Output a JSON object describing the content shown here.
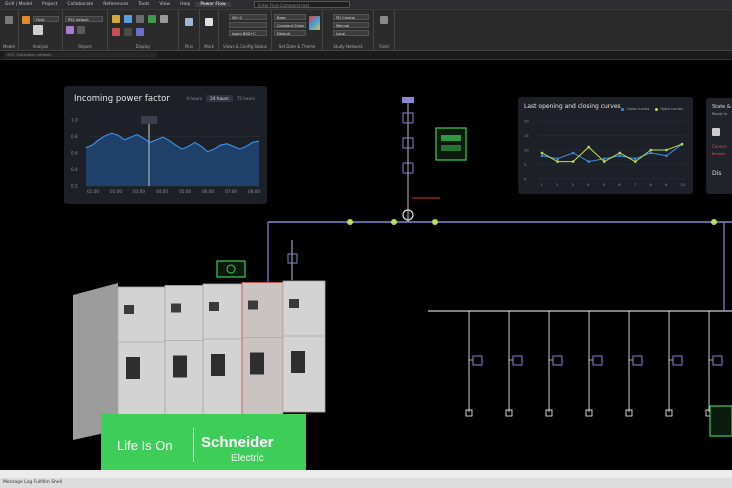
{
  "menubar": {
    "items": [
      "Grill | Model",
      "Project",
      "Collaborate",
      "References",
      "Tools",
      "View",
      "Help",
      "Power Flow"
    ],
    "search_placeholder": "Enter Find Command text"
  },
  "ribbon": {
    "groups": [
      "Model",
      "Analyze",
      "Report",
      "Display",
      "Pins",
      "Mark",
      "Views & Config Status",
      "Set Date & Theme",
      "Study Network",
      "Field"
    ],
    "controls": {
      "analyze_select": "Fault",
      "report_select": "PSC default",
      "views_select1": "SB+C",
      "views_select2": "",
      "views_select3": "Isang BSD+C",
      "theme_select1": "Base",
      "theme_select2": "Constant Show",
      "theme_select3": "Default",
      "network_select1": "PD Control",
      "network_select2": "Manual",
      "network_select3": "Local"
    }
  },
  "docbar": {
    "tab": "XYZ- Substation network"
  },
  "power_factor": {
    "title": "Incoming power factor",
    "tabs": [
      "4 hours",
      "24 hours",
      "72 hours"
    ],
    "selected_tab": 1,
    "y_ticks": [
      "1.0",
      "0.8",
      "0.6",
      "0.4",
      "0.2"
    ],
    "x_ticks": [
      "01:00",
      "02:00",
      "03:00",
      "04:00",
      "05:00",
      "06:00",
      "07:00",
      "08:00"
    ],
    "line_color": "#3a8de0",
    "fill_color": "#1f4f86"
  },
  "curves": {
    "title": "Last opening and closing curves",
    "legend": [
      {
        "label": "Close curves",
        "color": "#3a8de0"
      },
      {
        "label": "Open curves",
        "color": "#b9e05a"
      }
    ],
    "y_ticks": [
      "20",
      "15",
      "10",
      "5",
      "0"
    ],
    "x_ticks": [
      "1",
      "2",
      "3",
      "4",
      "5",
      "6",
      "7",
      "8",
      "9",
      "10"
    ],
    "series1_color": "#3a8de0",
    "series2_color": "#b9e05a",
    "series1": [
      8,
      7,
      9,
      6,
      7,
      8,
      7,
      9,
      8,
      12
    ],
    "series2": [
      9,
      6,
      6,
      11,
      6,
      9,
      6,
      10,
      10,
      12
    ]
  },
  "side_card": {
    "lines": [
      "State &",
      "Ready fo",
      "",
      "Connec",
      "Breaker",
      "Dis"
    ]
  },
  "diagram": {
    "busbar_color": "#8a86d8",
    "feeder_color": "#ffffff",
    "trip_color": "#d23b3b",
    "status_green": "#3dcd58",
    "node_green": "#b9e05a"
  },
  "brand": {
    "slogan": "Life Is On",
    "name": "Schneider",
    "sub": "Electric"
  },
  "statusbar": {
    "text": "Message Log  Fullfilm  Shell"
  }
}
